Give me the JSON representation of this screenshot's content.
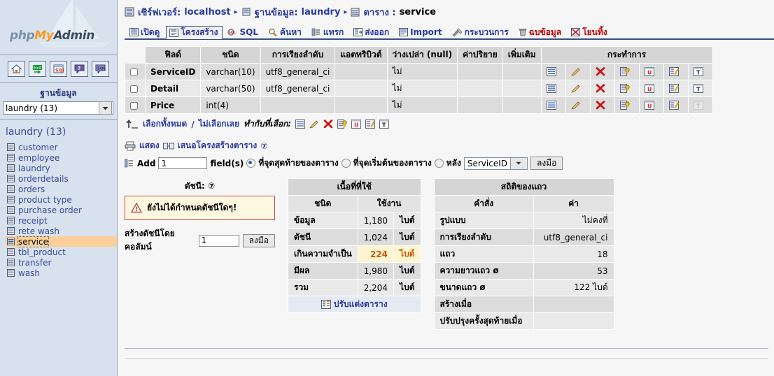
{
  "sidebar": {
    "logo": {
      "part1": "php",
      "part2": "My",
      "part3": "Admin"
    },
    "icon_buttons": [
      {
        "name": "home-icon",
        "label": "Home"
      },
      {
        "name": "logout-icon",
        "label": "Exit"
      },
      {
        "name": "sql-icon",
        "label": "SQL"
      },
      {
        "name": "help-icon",
        "label": "?"
      },
      {
        "name": "sql-query-icon",
        "label": "SQL"
      }
    ],
    "db_label": "ฐานข้อมูล",
    "db_select_value": "laundry (13)",
    "db_title": "laundry (13)",
    "tables": [
      {
        "name": "customer",
        "selected": false
      },
      {
        "name": "employee",
        "selected": false
      },
      {
        "name": "laundry",
        "selected": false
      },
      {
        "name": "orderdetails",
        "selected": false
      },
      {
        "name": "orders",
        "selected": false
      },
      {
        "name": "product type",
        "selected": false
      },
      {
        "name": "purchase order",
        "selected": false
      },
      {
        "name": "receipt",
        "selected": false
      },
      {
        "name": "rete wash",
        "selected": false
      },
      {
        "name": "service",
        "selected": true
      },
      {
        "name": "tbl_product",
        "selected": false
      },
      {
        "name": "transfer",
        "selected": false
      },
      {
        "name": "wash",
        "selected": false
      }
    ]
  },
  "breadcrumb": {
    "server_label": "เซิร์ฟเวอร์:",
    "server_value": "localhost",
    "db_label": "ฐานข้อมูล:",
    "db_value": "laundry",
    "table_label": "ตาราง :",
    "table_value": "service",
    "separator": "▸"
  },
  "tabs": [
    {
      "label": "เปิดดู",
      "icon": "browse-icon",
      "active": false,
      "danger": false
    },
    {
      "label": "โครงสร้าง",
      "icon": "structure-icon",
      "active": true,
      "danger": false
    },
    {
      "label": "SQL",
      "icon": "sql-icon",
      "active": false,
      "danger": false
    },
    {
      "label": "ค้นหา",
      "icon": "search-icon",
      "active": false,
      "danger": false
    },
    {
      "label": "แทรก",
      "icon": "insert-icon",
      "active": false,
      "danger": false
    },
    {
      "label": "ส่งออก",
      "icon": "export-icon",
      "active": false,
      "danger": false
    },
    {
      "label": "Import",
      "icon": "import-icon",
      "active": false,
      "danger": false
    },
    {
      "label": "กระบวนการ",
      "icon": "operations-icon",
      "active": false,
      "danger": false
    },
    {
      "label": "ฉบข้อมูล",
      "icon": "empty-icon",
      "active": false,
      "danger": true
    },
    {
      "label": "โยนทิ้ง",
      "icon": "drop-icon",
      "active": false,
      "danger": true
    }
  ],
  "structure": {
    "columns": [
      "ฟิลด์",
      "ชนิด",
      "การเรียงลำดับ",
      "แอตทริบิวต์",
      "ว่างเปล่า (null)",
      "ค่าปริยาย",
      "เพิ่มเติม"
    ],
    "action_header": "กระทำการ",
    "rows": [
      {
        "field": "ServiceID",
        "type": "varchar(10)",
        "collation": "utf8_general_ci",
        "attributes": "",
        "null": "ไม่",
        "default": "",
        "extra": "",
        "fulltext_enabled": true
      },
      {
        "field": "Detail",
        "type": "varchar(50)",
        "collation": "utf8_general_ci",
        "attributes": "",
        "null": "ไม่",
        "default": "",
        "extra": "",
        "fulltext_enabled": true
      },
      {
        "field": "Price",
        "type": "int(4)",
        "collation": "",
        "attributes": "",
        "null": "ไม่",
        "default": "",
        "extra": "",
        "fulltext_enabled": false
      }
    ],
    "row_actions": [
      "browse-icon",
      "edit-icon",
      "drop-icon",
      "primary-key-icon",
      "unique-icon",
      "index-icon",
      "fulltext-icon"
    ],
    "select_all": "เลือกทั้งหมด",
    "select_none": "ไม่เลือกเลย",
    "with_selected": "ทำกับที่เลือก:",
    "bulk_actions": [
      "browse-icon",
      "edit-icon",
      "drop-icon",
      "primary-key-icon",
      "unique-icon",
      "index-icon",
      "fulltext-icon"
    ]
  },
  "print_row": {
    "print_label": "แสดง",
    "propose_label": "เสนอโครงสร้างตาราง",
    "help": "⑦"
  },
  "add_field": {
    "add_label": "Add",
    "count_value": "1",
    "fields_label": "field(s)",
    "opt_end": "ที่จุดสุดท้ายของตาราง",
    "opt_begin": "ที่จุดเริ่มต้นของตาราง",
    "opt_after": "หลัง",
    "after_value": "ServiceID",
    "go_label": "ลงมือ",
    "selected_option": "end"
  },
  "index_panel": {
    "title": "ดัชนี:",
    "help": "⑦",
    "warning": "ยังไม่ได้กำหนดดัชนีใดๆ!",
    "create_label": "สร้างดัชนีโดยคอลัมน์",
    "create_value": "1",
    "go_label": "ลงมือ"
  },
  "space_panel": {
    "title": "เนื้อที่ที่ใช้",
    "col_type": "ชนิด",
    "col_usage": "ใช้งาน",
    "rows": [
      {
        "type": "ข้อมูล",
        "value": "1,180",
        "unit": "ไบต์",
        "highlight": false
      },
      {
        "type": "ดัชนี",
        "value": "1,024",
        "unit": "ไบต์",
        "highlight": false
      },
      {
        "type": "เกินความจำเป็น",
        "value": "224",
        "unit": "ไบต์",
        "highlight": true
      },
      {
        "type": "มีผล",
        "value": "1,980",
        "unit": "ไบต์",
        "highlight": false
      },
      {
        "type": "รวม",
        "value": "2,204",
        "unit": "ไบต์",
        "highlight": false
      }
    ],
    "optimize_label": "ปรับแต่งตาราง"
  },
  "stats_panel": {
    "title": "สถิติของแถว",
    "col_statement": "คำสั่ง",
    "col_value": "ค่า",
    "rows": [
      {
        "k": "รูปแบบ",
        "v": "ไม่คงที่"
      },
      {
        "k": "การเรียงลำดับ",
        "v": "utf8_general_ci"
      },
      {
        "k": "แถว",
        "v": "18"
      },
      {
        "k": "ความยาวแถว ø",
        "v": "53"
      },
      {
        "k": "ขนาดแถว ø",
        "v": "122 ไบต์"
      },
      {
        "k": "สร้างเมื่อ",
        "v": ""
      },
      {
        "k": "ปรับปรุงครั้งสุดท้ายเมื่อ",
        "v": ""
      }
    ]
  },
  "colors": {
    "sidebar_bg": "#d7e2ee",
    "link": "#2a3a9c",
    "selected_table": "#fbcf9a",
    "danger": "#bb0000",
    "warning_bg": "#fff8e0",
    "warning_border": "#cc4444",
    "highlight": "#fff4d0",
    "accent_orange": "#f79a21"
  }
}
